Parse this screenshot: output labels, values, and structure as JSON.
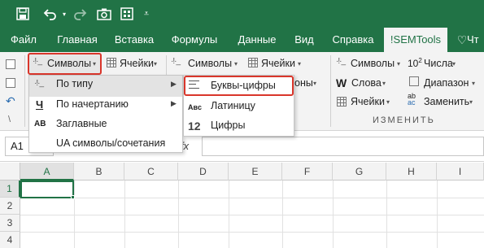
{
  "tabs": [
    "Файл",
    "Главная",
    "Вставка",
    "Формулы",
    "Данные",
    "Вид",
    "Справка",
    "!SEMTools",
    "Чт"
  ],
  "ribbon": {
    "symbols_label": "Символы",
    "cells_label": "Ячейки",
    "symbols2_label": "Символы",
    "cells2_label": "Ячейки",
    "col3": {
      "symbols": "Символы",
      "words": "Слова",
      "cells": "Ячейки",
      "numbers": "Числа",
      "numbers_sup": "10",
      "numbers_base": "2",
      "range": "Диапазон",
      "replace": "Заменить",
      "replace_a": "ab",
      "replace_c": "ac",
      "group_label": "ИЗМЕНИТЬ"
    },
    "partial_ony": "оны"
  },
  "menu1": {
    "items": [
      {
        "label": "По типу",
        "icon": "",
        "has_sub": true
      },
      {
        "label": "По начертанию",
        "icon": "Ч",
        "has_sub": true
      },
      {
        "label": "Заглавные",
        "icon": "AB",
        "has_sub": false
      },
      {
        "label": "UA символы/сочетания",
        "icon": "",
        "has_sub": false
      }
    ]
  },
  "menu2": {
    "items": [
      {
        "label": "Буквы-цифры",
        "icon": "lines-icon"
      },
      {
        "label": "Латиницу",
        "icon": "Aвc"
      },
      {
        "label": "Цифры",
        "icon": "12"
      }
    ]
  },
  "formula_bar": {
    "name_box": "A1",
    "fx": "fx"
  },
  "grid": {
    "columns": [
      "A",
      "B",
      "C",
      "D",
      "E",
      "F",
      "G",
      "H",
      "I"
    ],
    "rows": [
      "1",
      "2",
      "3",
      "4"
    ],
    "active_cell": "A1"
  },
  "colors": {
    "excel_green": "#217346",
    "highlight_red": "#d9362b"
  }
}
